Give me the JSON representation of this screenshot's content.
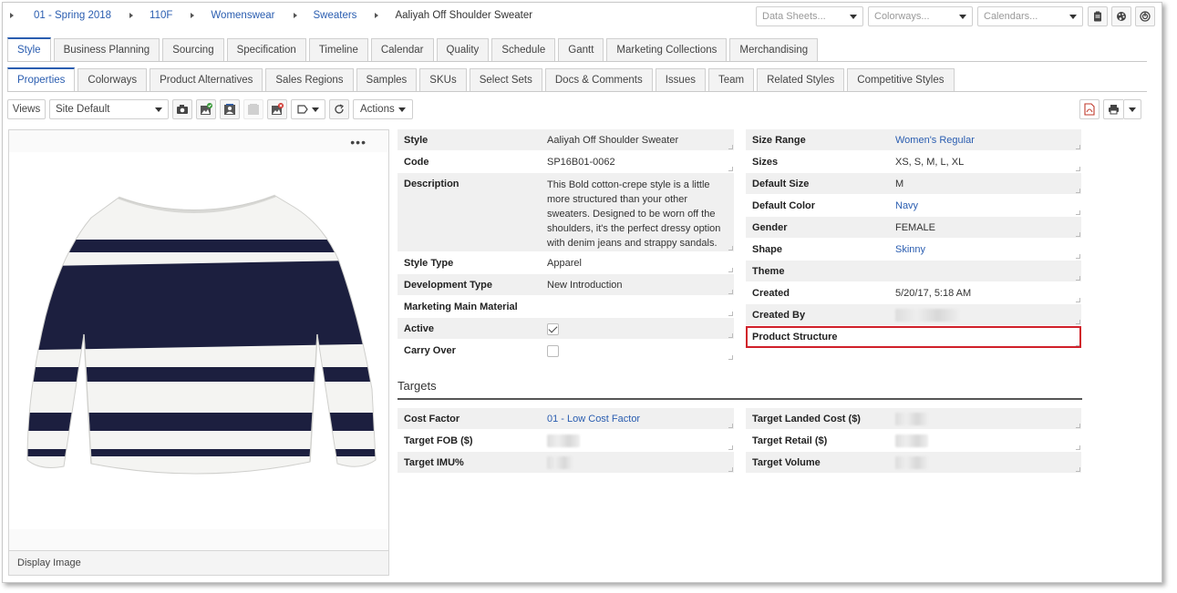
{
  "breadcrumb": [
    "01 - Spring 2018",
    "110F",
    "Womenswear",
    "Sweaters",
    "Aaliyah Off Shoulder Sweater"
  ],
  "top_selects": [
    {
      "placeholder": "Data Sheets..."
    },
    {
      "placeholder": "Colorways..."
    },
    {
      "placeholder": "Calendars..."
    }
  ],
  "top_icons": [
    "clipboard-icon",
    "palette-icon",
    "spiral-icon"
  ],
  "main_tabs": [
    "Style",
    "Business Planning",
    "Sourcing",
    "Specification",
    "Timeline",
    "Calendar",
    "Quality",
    "Schedule",
    "Gantt",
    "Marketing Collections",
    "Merchandising"
  ],
  "main_active": "Style",
  "sub_tabs": [
    "Properties",
    "Colorways",
    "Product Alternatives",
    "Sales Regions",
    "Samples",
    "SKUs",
    "Select Sets",
    "Docs & Comments",
    "Issues",
    "Team",
    "Related Styles",
    "Competitive Styles"
  ],
  "sub_active": "Properties",
  "toolbar": {
    "views_label": "Views",
    "view_select": "Site Default",
    "actions_label": "Actions"
  },
  "image_panel": {
    "caption": "Display Image",
    "more": "•••"
  },
  "left_props": [
    {
      "label": "Style",
      "value": "Aaliyah Off Shoulder Sweater"
    },
    {
      "label": "Code",
      "value": "SP16B01-0062"
    },
    {
      "label": "Description",
      "value": "This Bold cotton-crepe style is a little more structured than your other sweaters. Designed to be worn off the shoulders, it's the perfect dressy option with denim jeans and strappy sandals."
    },
    {
      "label": "Style Type",
      "value": "Apparel"
    },
    {
      "label": "Development Type",
      "value": "New Introduction"
    },
    {
      "label": "Marketing Main Material",
      "value": ""
    },
    {
      "label": "Active",
      "value": "checked"
    },
    {
      "label": "Carry Over",
      "value": "unchecked"
    }
  ],
  "right_props": [
    {
      "label": "Size Range",
      "value": "Women's Regular"
    },
    {
      "label": "Sizes",
      "value": "XS, S, M, L, XL"
    },
    {
      "label": "Default Size",
      "value": "M"
    },
    {
      "label": "Default Color",
      "value": "Navy"
    },
    {
      "label": "Gender",
      "value": "FEMALE"
    },
    {
      "label": "Shape",
      "value": "Skinny"
    },
    {
      "label": "Theme",
      "value": ""
    },
    {
      "label": "Created",
      "value": "5/20/17, 5:18 AM"
    },
    {
      "label": "Created By",
      "value": ""
    },
    {
      "label": "Product Structure",
      "value": ""
    }
  ],
  "targets": {
    "title": "Targets",
    "left": [
      {
        "label": "Cost Factor",
        "value": "01 - Low Cost Factor"
      },
      {
        "label": "Target FOB ($)",
        "value": ""
      },
      {
        "label": "Target IMU%",
        "value": ""
      }
    ],
    "right": [
      {
        "label": "Target Landed Cost ($)",
        "value": ""
      },
      {
        "label": "Target Retail ($)",
        "value": ""
      },
      {
        "label": "Target Volume",
        "value": ""
      }
    ]
  },
  "colors": {
    "accent": "#2a5db0",
    "highlight": "#d0202a",
    "navy": "#1c1f3f"
  }
}
